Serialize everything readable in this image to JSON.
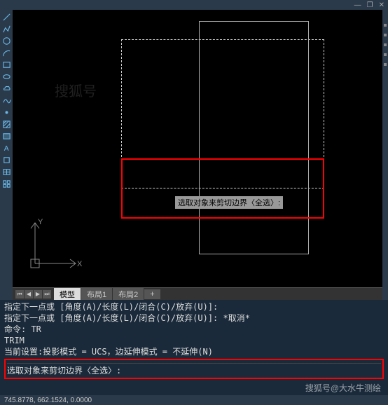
{
  "top": {
    "min": "—",
    "restore": "❐",
    "close": "✕"
  },
  "tooltip": "选取对象来剪切边界〈全选〉:",
  "tabs": {
    "model": "模型",
    "layout1": "布局1",
    "layout2": "布局2",
    "plus": "+"
  },
  "axes": {
    "x": "X",
    "y": "Y"
  },
  "cmd": {
    "line1": "指定下一点或 [角度(A)/长度(L)/闭合(C)/放弃(U)]:",
    "line2": "指定下一点或 [角度(A)/长度(L)/闭合(C)/放弃(U)]: *取消*",
    "line3": "命令: TR",
    "line4": "TRIM",
    "line5": "当前设置:投影模式 = UCS，边延伸模式 = 不延伸(N)",
    "line6": "",
    "input": "选取对象来剪切边界〈全选〉:"
  },
  "status": "745.8778, 662.1524, 0.0000",
  "watermark": {
    "center": "搜狐号",
    "corner": "搜狐号@大水牛测绘"
  }
}
